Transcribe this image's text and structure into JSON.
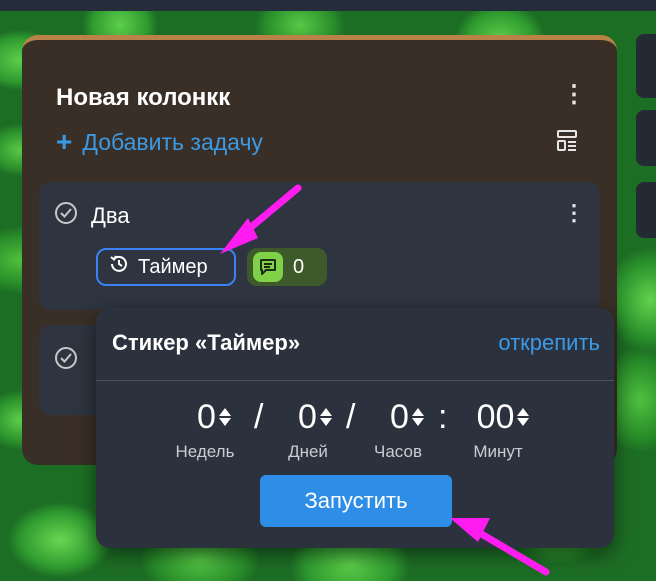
{
  "column": {
    "title": "Новая колонкк",
    "menu_icon": "more-vertical-icon",
    "add_task_label": "Добавить задачу",
    "template_icon": "template-icon"
  },
  "cards": [
    {
      "title": "Два",
      "timer_badge": "Таймер",
      "comments_count": "0"
    }
  ],
  "popup": {
    "title": "Стикер «Таймер»",
    "unpin_label": "открепить",
    "weeks": "0",
    "weeks_label": "Недель",
    "sep1": "/",
    "days": "0",
    "days_label": "Дней",
    "sep2": "/",
    "hours": "0",
    "hours_label": "Часов",
    "sep3": ":",
    "minutes": "00",
    "minutes_label": "Минут",
    "start_label": "Запустить"
  },
  "colors": {
    "accent_blue": "#3b9ae6",
    "annotation_arrow": "#ff1cf0",
    "column_top_border": "#b98347",
    "comment_badge_icon": "#7fd148"
  }
}
